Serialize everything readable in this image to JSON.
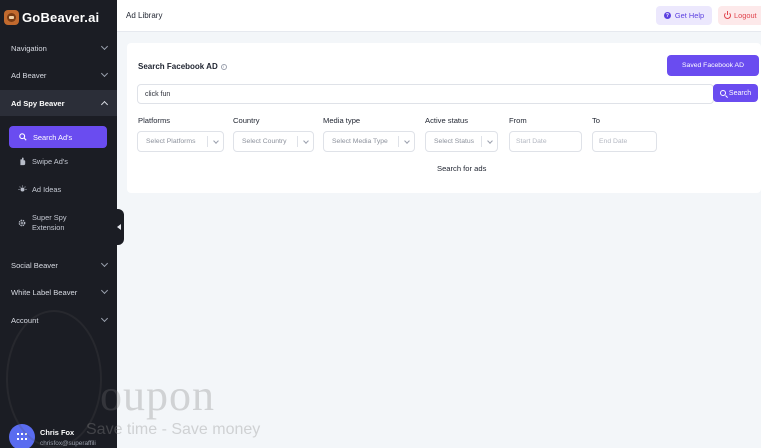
{
  "brand": {
    "name": "GoBeaver.ai",
    "accent": "#6a4cf0",
    "sidebar_bg": "#1b1d24"
  },
  "sidebar": {
    "sections": [
      {
        "label": "Navigation",
        "expanded": false
      },
      {
        "label": "Ad Beaver",
        "expanded": false
      },
      {
        "label": "Ad Spy Beaver",
        "expanded": true
      },
      {
        "label": "Social Beaver",
        "expanded": false
      },
      {
        "label": "White Label Beaver",
        "expanded": false
      },
      {
        "label": "Account",
        "expanded": false
      }
    ],
    "sub_items": [
      {
        "label": "Search Ad's",
        "icon": "search-icon",
        "active": true
      },
      {
        "label": "Swipe Ad's",
        "icon": "hand-icon",
        "active": false
      },
      {
        "label": "Ad Ideas",
        "icon": "lightbulb-icon",
        "active": false
      },
      {
        "label_line1": "Super Spy",
        "label_line2": "Extension",
        "icon": "gear-icon",
        "active": false
      }
    ],
    "user": {
      "name": "Chris Fox",
      "email": "chrisfox@superaffili"
    }
  },
  "header": {
    "title": "Ad Library",
    "help_label": "Get Help",
    "logout_label": "Logout"
  },
  "search_panel": {
    "title": "Search Facebook AD",
    "saved_button": "Saved Facebook AD",
    "query_value": "click fun",
    "search_button": "Search",
    "filters": {
      "platforms": {
        "label": "Platforms",
        "placeholder": "Select Platforms"
      },
      "country": {
        "label": "Country",
        "placeholder": "Select Country"
      },
      "media_type": {
        "label": "Media type",
        "placeholder": "Select Media Type"
      },
      "active_status": {
        "label": "Active status",
        "placeholder": "Select Status"
      },
      "from": {
        "label": "From",
        "placeholder": "Start Date"
      },
      "to": {
        "label": "To",
        "placeholder": "End Date"
      }
    },
    "status_text": "Search for ads"
  },
  "watermark": {
    "word": "oupon",
    "tagline": "Save time - Save money"
  }
}
